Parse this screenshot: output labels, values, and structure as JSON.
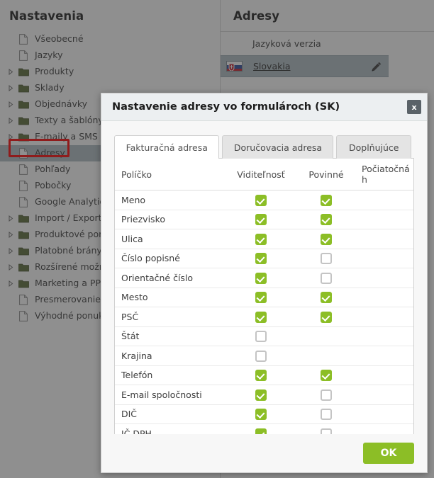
{
  "sidebar": {
    "title": "Nastavenia",
    "items": [
      {
        "label": "Všeobecné",
        "type": "file",
        "selected": false
      },
      {
        "label": "Jazyky",
        "type": "file",
        "selected": false
      },
      {
        "label": "Produkty",
        "type": "folder",
        "selected": false
      },
      {
        "label": "Sklady",
        "type": "folder",
        "selected": false
      },
      {
        "label": "Objednávky",
        "type": "folder",
        "selected": false
      },
      {
        "label": "Texty a šablóny",
        "type": "folder",
        "selected": false
      },
      {
        "label": "E-maily a SMS",
        "type": "folder",
        "selected": false
      },
      {
        "label": "Adresy",
        "type": "file",
        "selected": true
      },
      {
        "label": "Pohľady",
        "type": "file",
        "selected": false
      },
      {
        "label": "Pobočky",
        "type": "file",
        "selected": false
      },
      {
        "label": "Google Analytics",
        "type": "file",
        "selected": false
      },
      {
        "label": "Import / Export",
        "type": "folder",
        "selected": false
      },
      {
        "label": "Produktové porovnávače",
        "type": "folder",
        "selected": false
      },
      {
        "label": "Platobné brány",
        "type": "folder",
        "selected": false
      },
      {
        "label": "Rozšírené možnosti",
        "type": "folder",
        "selected": false
      },
      {
        "label": "Marketing a PPC",
        "type": "folder",
        "selected": false
      },
      {
        "label": "Presmerovanie",
        "type": "file",
        "selected": false
      },
      {
        "label": "Výhodné ponuky",
        "type": "file",
        "selected": false
      }
    ]
  },
  "content": {
    "title": "Adresy",
    "lang_header": "Jazyková verzia",
    "language_row": {
      "name": "Slovakia",
      "flag": "slovakia-flag-icon",
      "edit_icon": "pencil-icon"
    }
  },
  "modal": {
    "title": "Nastavenie adresy vo formulároch (SK)",
    "close_label": "x",
    "ok_label": "OK",
    "tabs": [
      {
        "label": "Fakturačná adresa",
        "active": true
      },
      {
        "label": "Doručovacia adresa",
        "active": false
      },
      {
        "label": "Doplňujúce",
        "active": false
      }
    ],
    "table": {
      "columns": [
        "Políčko",
        "Viditeľnosť",
        "Povinné",
        "Počiatočná h"
      ],
      "rows": [
        {
          "field": "Meno",
          "visible": true,
          "required": true,
          "has_required": true,
          "initial": ""
        },
        {
          "field": "Priezvisko",
          "visible": true,
          "required": true,
          "has_required": true,
          "initial": ""
        },
        {
          "field": "Ulica",
          "visible": true,
          "required": true,
          "has_required": true,
          "initial": ""
        },
        {
          "field": "Číslo popisné",
          "visible": true,
          "required": false,
          "has_required": true,
          "initial": ""
        },
        {
          "field": "Orientačné číslo",
          "visible": true,
          "required": false,
          "has_required": true,
          "initial": ""
        },
        {
          "field": "Mesto",
          "visible": true,
          "required": true,
          "has_required": true,
          "initial": ""
        },
        {
          "field": "PSČ",
          "visible": true,
          "required": true,
          "has_required": true,
          "initial": ""
        },
        {
          "field": "Štát",
          "visible": false,
          "required": false,
          "has_required": false,
          "initial": ""
        },
        {
          "field": "Krajina",
          "visible": false,
          "required": false,
          "has_required": false,
          "initial": ""
        },
        {
          "field": "Telefón",
          "visible": true,
          "required": true,
          "has_required": true,
          "initial": ""
        },
        {
          "field": "E-mail spoločnosti",
          "visible": true,
          "required": false,
          "has_required": true,
          "initial": ""
        },
        {
          "field": "DIČ",
          "visible": true,
          "required": false,
          "has_required": true,
          "initial": ""
        },
        {
          "field": "IČ DPH",
          "visible": true,
          "required": false,
          "has_required": true,
          "initial": ""
        }
      ]
    }
  },
  "colors": {
    "accent_green": "#8cbe26",
    "selection": "#b0bcc4",
    "highlight_box": "#ff0000",
    "folder": "#5a6b35"
  }
}
